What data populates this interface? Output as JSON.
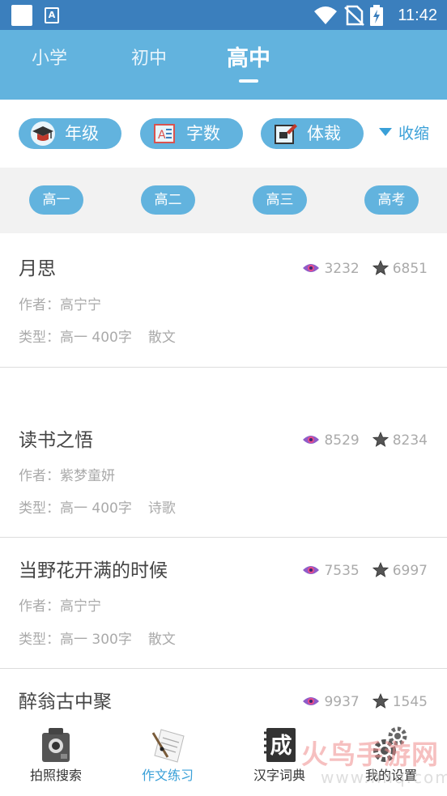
{
  "status_bar": {
    "time": "11:42",
    "notification_icon": "square-notification-icon",
    "a_icon": "A",
    "wifi_icon": "wifi-icon",
    "signal_icon": "no-sim-icon",
    "battery_icon": "battery-charging-icon"
  },
  "level_tabs": [
    {
      "label": "小学",
      "active": false
    },
    {
      "label": "初中",
      "active": false
    },
    {
      "label": "高中",
      "active": true
    }
  ],
  "filters": {
    "grade_label": "年级",
    "words_label": "字数",
    "genre_label": "体裁",
    "collapse_label": "收缩"
  },
  "grades": [
    "高一",
    "高二",
    "高三",
    "高考"
  ],
  "essays": [
    {
      "title": "月思",
      "views": "3232",
      "stars": "6851",
      "author_prefix": "作者：",
      "author": "高宁宁",
      "type_prefix": "类型：",
      "grade": "高一",
      "words": "400字",
      "genre": "散文"
    },
    {
      "title": "读书之悟",
      "views": "8529",
      "stars": "8234",
      "author_prefix": "作者：",
      "author": "紫梦童妍",
      "type_prefix": "类型：",
      "grade": "高一",
      "words": "400字",
      "genre": "诗歌"
    },
    {
      "title": "当野花开满的时候",
      "views": "7535",
      "stars": "6997",
      "author_prefix": "作者：",
      "author": "高宁宁",
      "type_prefix": "类型：",
      "grade": "高一",
      "words": "300字",
      "genre": "散文"
    },
    {
      "title": "醉翁古中聚",
      "views": "9937",
      "stars": "1545"
    }
  ],
  "bottom_nav": [
    {
      "label": "拍照搜索",
      "icon": "camera-icon",
      "active": false
    },
    {
      "label": "作文练习",
      "icon": "pen-paper-icon",
      "active": true
    },
    {
      "label": "汉字词典",
      "icon": "dictionary-cheng-icon",
      "glyph": "成",
      "active": false
    },
    {
      "label": "我的设置",
      "icon": "gear-icon",
      "active": false
    }
  ],
  "watermark": {
    "text": "火鸟手游网",
    "url": "www.hnq.com"
  },
  "colors": {
    "status_bar": "#3b7fbd",
    "tab_bar": "#62b3de",
    "pill": "#62b3de",
    "accent": "#3aa0d8",
    "grade_row_bg": "#f2f2f2"
  }
}
